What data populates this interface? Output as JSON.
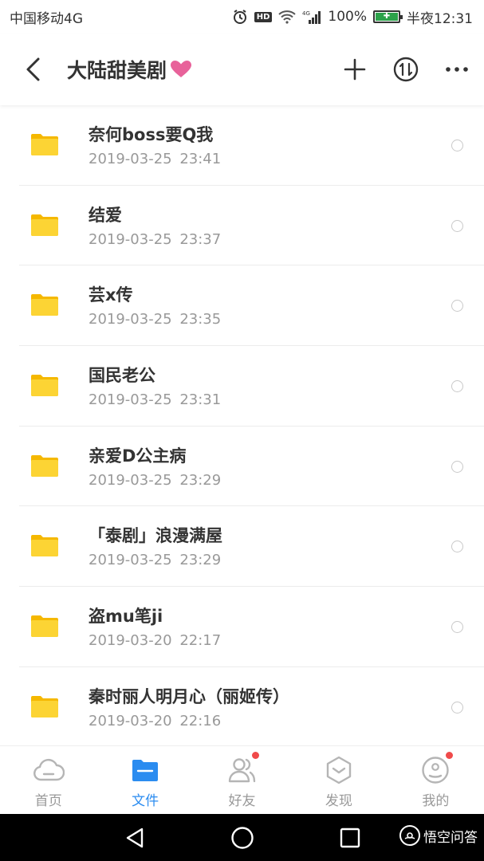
{
  "status_bar": {
    "carrier": "中国移动4G",
    "battery_percent": "100%",
    "time": "半夜12:31",
    "hd_badge": "HD",
    "network_small": "4G",
    "battery_level": 1.0
  },
  "header": {
    "title": "大陆甜美剧",
    "heart_color": "#e8629a"
  },
  "files": [
    {
      "name": "奈何boss要Q我",
      "date": "2019-03-25 23:41"
    },
    {
      "name": "结爱",
      "date": "2019-03-25 23:37"
    },
    {
      "name": "芸x传",
      "date": "2019-03-25 23:35"
    },
    {
      "name": "国民老公",
      "date": "2019-03-25 23:31"
    },
    {
      "name": "亲爱D公主病",
      "date": "2019-03-25 23:29"
    },
    {
      "name": "「泰剧」浪漫满屋",
      "date": "2019-03-25 23:29"
    },
    {
      "name": "盗mu笔ji",
      "date": "2019-03-20 22:17"
    },
    {
      "name": "秦时丽人明月心（丽姬传）",
      "date": "2019-03-20 22:16"
    }
  ],
  "tabs": [
    {
      "label": "首页",
      "icon": "cloud-icon",
      "active": false,
      "badge": false
    },
    {
      "label": "文件",
      "icon": "folder-icon",
      "active": true,
      "badge": false
    },
    {
      "label": "好友",
      "icon": "friends-icon",
      "active": false,
      "badge": true
    },
    {
      "label": "发现",
      "icon": "discover-icon",
      "active": false,
      "badge": false
    },
    {
      "label": "我的",
      "icon": "profile-icon",
      "active": false,
      "badge": true
    }
  ],
  "watermark": {
    "text": "悟空问答"
  },
  "colors": {
    "accent": "#2b8cf0",
    "folder": "#f9c713",
    "badge": "#f04a4a",
    "text_secondary": "#999999"
  }
}
